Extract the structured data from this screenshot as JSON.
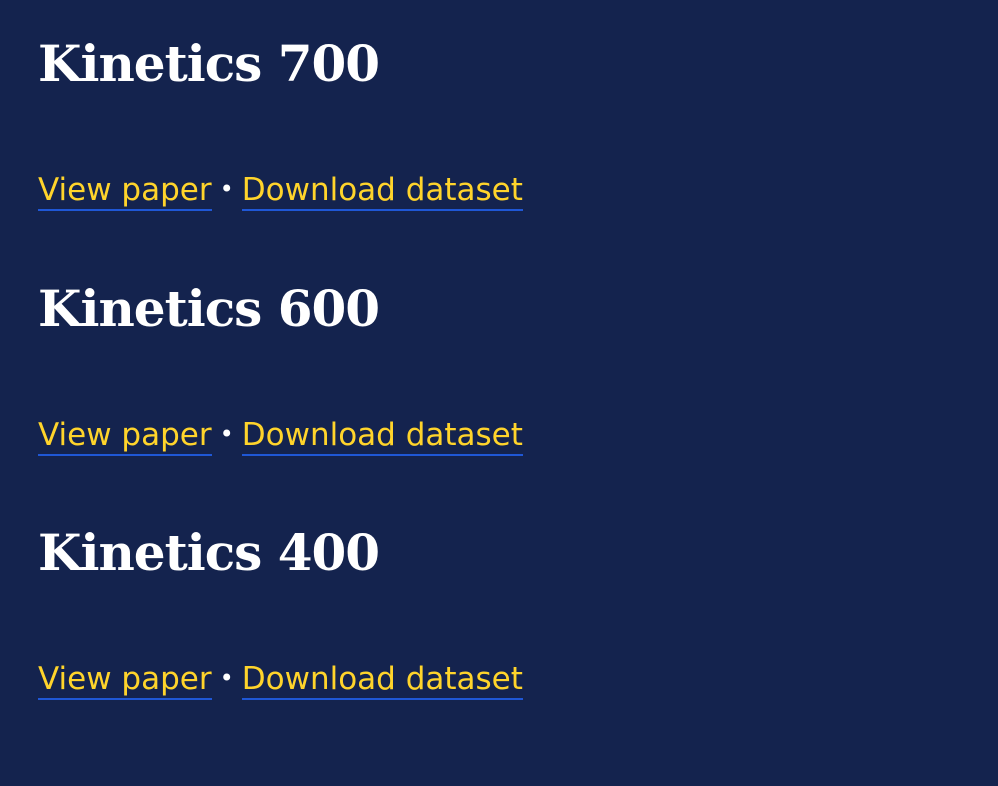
{
  "colors": {
    "background": "#14234e",
    "heading": "#ffffff",
    "link": "#ffd42b",
    "link_underline": "#1f57d6"
  },
  "separator": "•",
  "datasets": [
    {
      "title": "Kinetics 700",
      "paper_label": "View paper",
      "download_label": "Download dataset"
    },
    {
      "title": "Kinetics 600",
      "paper_label": "View paper",
      "download_label": "Download dataset"
    },
    {
      "title": "Kinetics 400",
      "paper_label": "View paper",
      "download_label": "Download dataset"
    }
  ]
}
